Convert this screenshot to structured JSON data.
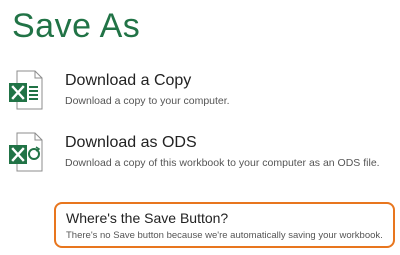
{
  "page": {
    "title": "Save As"
  },
  "options": [
    {
      "title": "Download a Copy",
      "description": "Download a copy to your computer.",
      "icon": "excel-file-icon"
    },
    {
      "title": "Download as ODS",
      "description": "Download a copy of this workbook to your computer as an ODS file.",
      "icon": "excel-ods-file-icon"
    }
  ],
  "info": {
    "title": "Where's the Save Button?",
    "description": "There's no Save button because we're automatically saving your workbook."
  },
  "colors": {
    "accent": "#217346",
    "highlight_border": "#e8761e"
  }
}
